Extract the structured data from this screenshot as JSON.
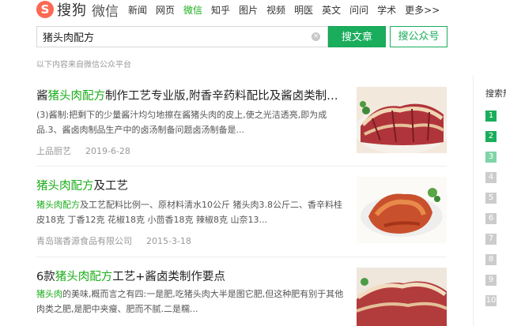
{
  "header": {
    "logo_text": "搜狗",
    "logo_sub": "微信",
    "nav": [
      "新闻",
      "网页",
      "微信",
      "知乎",
      "图片",
      "视频",
      "明医",
      "英文",
      "问问",
      "学术",
      "更多>>"
    ],
    "active_nav_index": 2
  },
  "search": {
    "query": "猪头肉配方",
    "btn_article": "搜文章",
    "btn_account": "搜公众号"
  },
  "source_note": "以下内容来自微信公众平台",
  "results": [
    {
      "title_pre": "酱",
      "title_hl": "猪头肉配方",
      "title_post": "制作工艺专业版,附香辛药料配比及酱卤类制作要点",
      "snippet": "(3)酱制:把剩下的少量酱汁均匀地擦在酱猪头肉的皮上,使之光洁透亮,即为成品.3、酱卤肉制品生产中的卤汤制备问题卤汤制备是...",
      "source": "上品厨艺",
      "date": "2019-6-28"
    },
    {
      "title_hl": "猪头肉配方",
      "title_post": "及工艺",
      "snippet_hl": "猪头肉配方",
      "snippet": "及工艺配料比例一、原材料清水10公斤 猪头肉3.8公斤二、香辛料桂皮18克 丁香12克 花椒18克 小茴香18克 辣椒8克 山奈13...",
      "source": "青岛瑞香源食品有限公司",
      "date": "2015-3-18"
    },
    {
      "title_pre": "6款",
      "title_hl": "猪头肉配方",
      "title_post": "工艺+酱卤类制作要点",
      "snippet_hl": "猪头肉",
      "snippet": "的美味,概而言之有四:一是肥,吃猪头肉大半是图它肥,但这种肥有别于其他肉类之肥,是肥中夹瘦、肥而不腻.二是糯...",
      "source": "",
      "date": ""
    }
  ],
  "sidebar": {
    "title": "搜索热",
    "ranks": [
      "1",
      "2",
      "3",
      "4",
      "5",
      "6",
      "7",
      "8",
      "9",
      "10"
    ],
    "rank_colors": [
      "#1aad5c",
      "#1aad5c",
      "#7fd3a7",
      "#cccccc",
      "#cccccc",
      "#cccccc",
      "#cccccc",
      "#cccccc",
      "#cccccc",
      "#cccccc"
    ]
  }
}
